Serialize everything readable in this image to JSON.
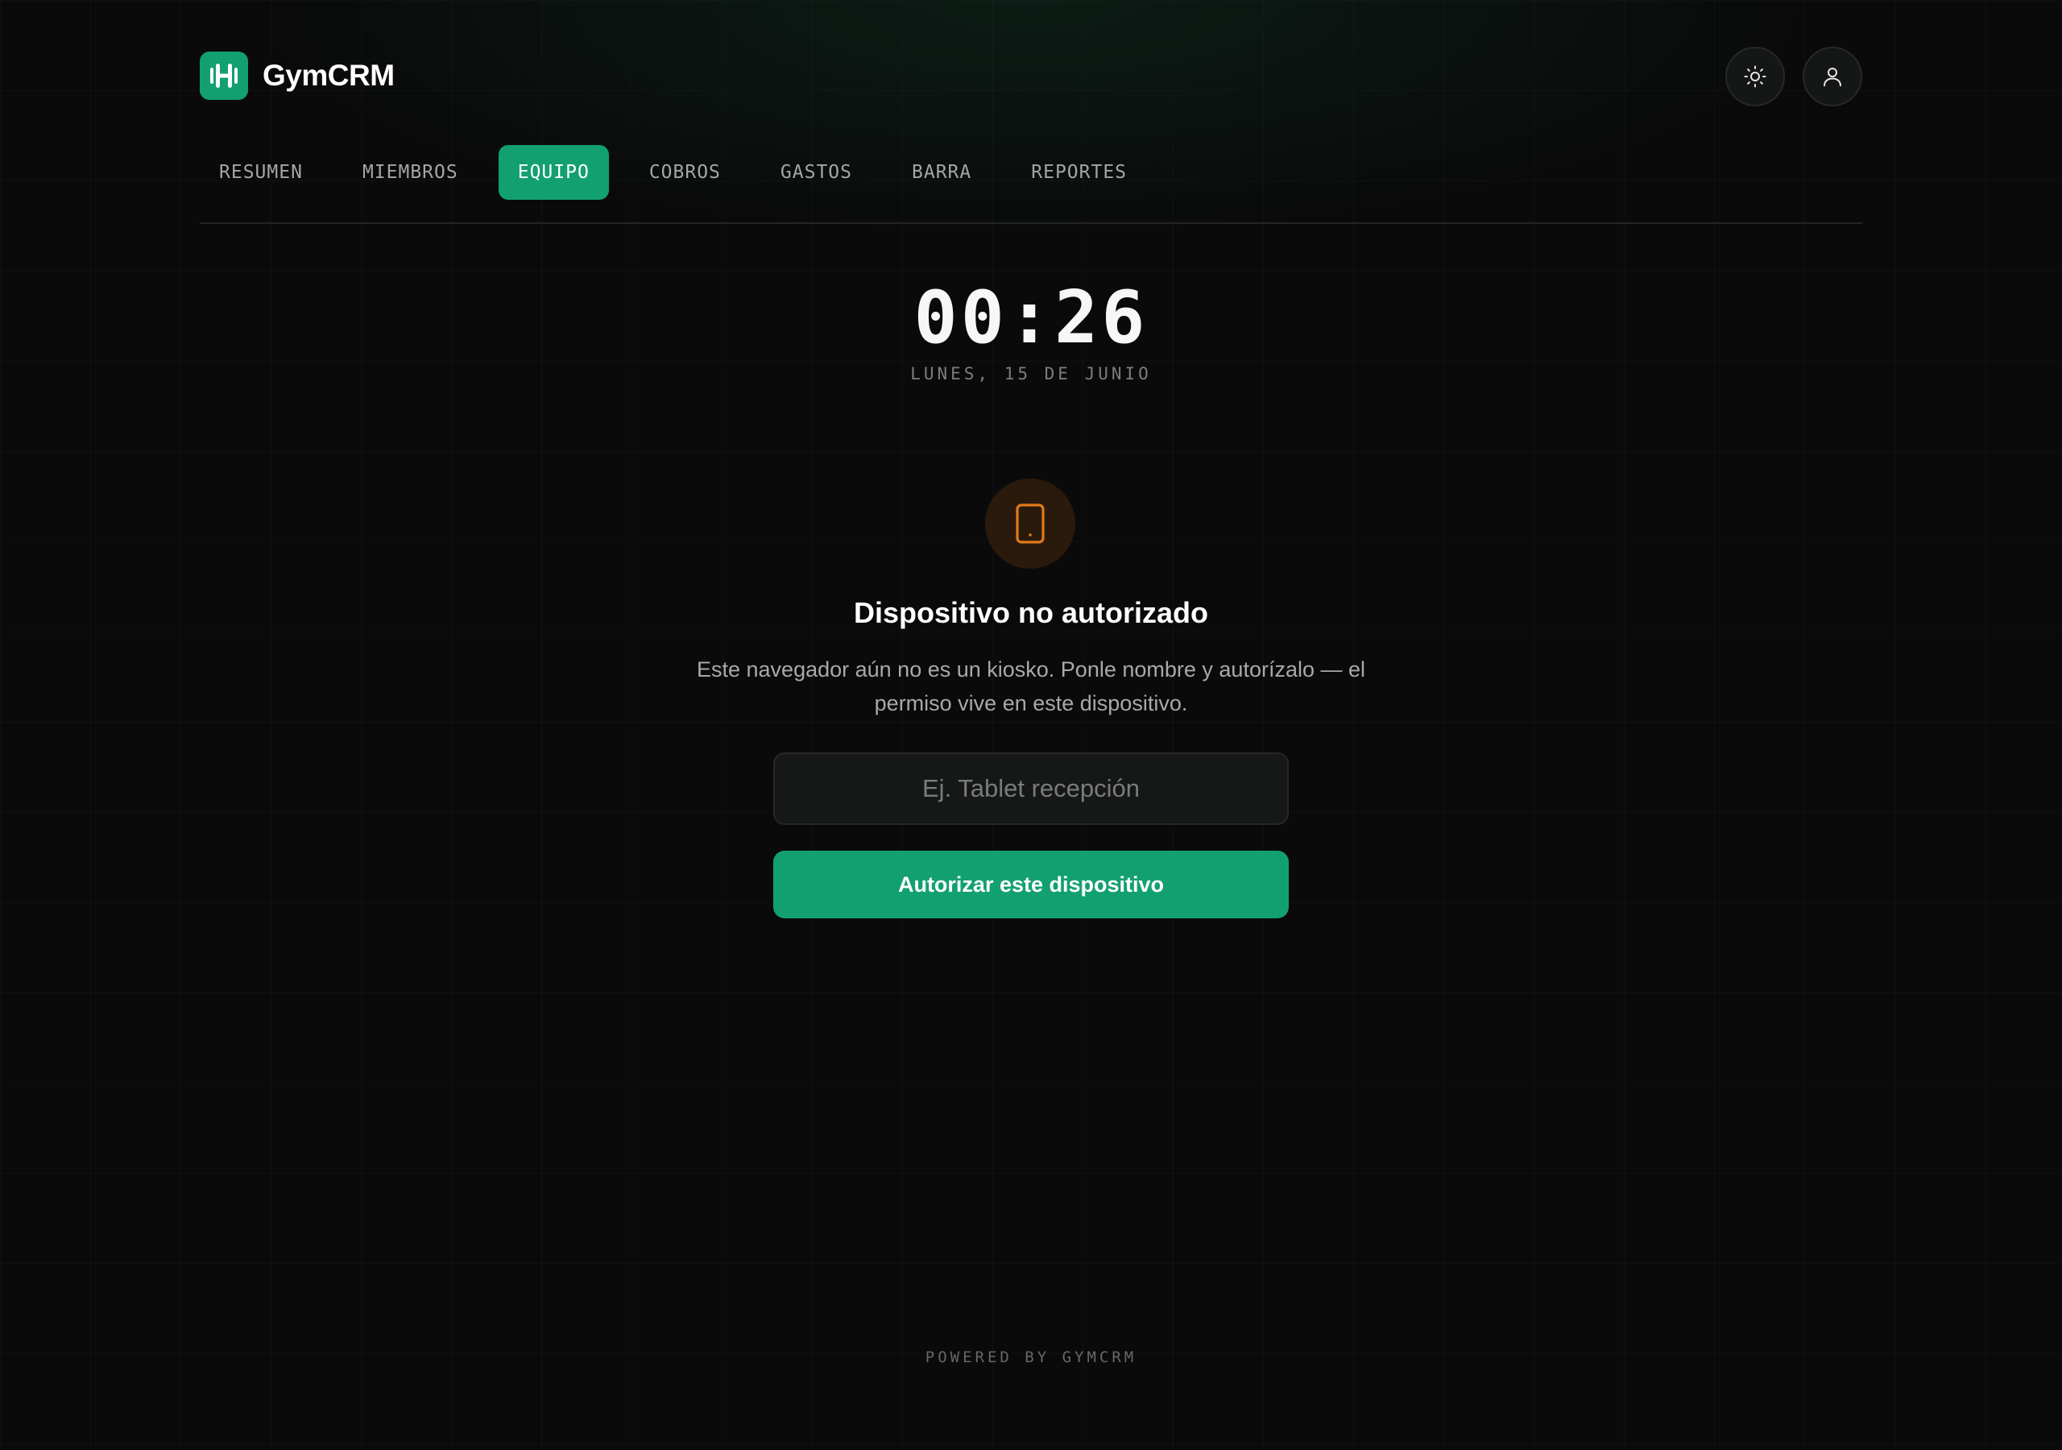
{
  "app": {
    "name": "GymCRM",
    "logo_icon": "dumbbell-icon",
    "accent_color": "#12a070"
  },
  "header": {
    "theme_toggle_icon": "sun-icon",
    "profile_icon": "user-icon"
  },
  "nav": {
    "tabs": [
      {
        "label": "RESUMEN",
        "active": false
      },
      {
        "label": "MIEMBROS",
        "active": false
      },
      {
        "label": "EQUIPO",
        "active": true
      },
      {
        "label": "COBROS",
        "active": false
      },
      {
        "label": "GASTOS",
        "active": false
      },
      {
        "label": "BARRA",
        "active": false
      },
      {
        "label": "REPORTES",
        "active": false
      }
    ]
  },
  "clock": {
    "time": "00:26",
    "date": "LUNES, 15 DE JUNIO"
  },
  "authorization": {
    "icon": "tablet-icon",
    "icon_color": "#e07a1a",
    "title": "Dispositivo no autorizado",
    "description": "Este navegador aún no es un kiosko. Ponle nombre y autorízalo — el permiso vive en este dispositivo.",
    "input_placeholder": "Ej. Tablet recepción",
    "input_value": "",
    "button_label": "Autorizar este dispositivo"
  },
  "footer": {
    "text": "POWERED BY GYMCRM"
  }
}
